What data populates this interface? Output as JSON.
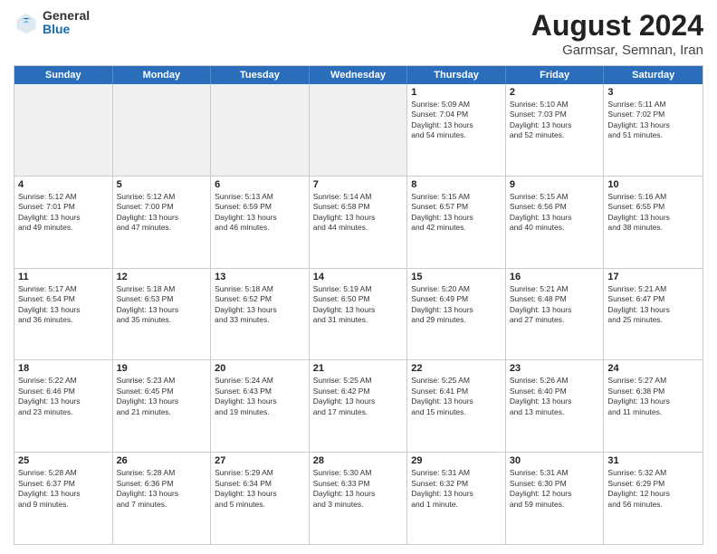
{
  "logo": {
    "general": "General",
    "blue": "Blue"
  },
  "title": {
    "month": "August 2024",
    "location": "Garmsar, Semnan, Iran"
  },
  "header_days": [
    "Sunday",
    "Monday",
    "Tuesday",
    "Wednesday",
    "Thursday",
    "Friday",
    "Saturday"
  ],
  "weeks": [
    [
      {
        "day": "",
        "info": ""
      },
      {
        "day": "",
        "info": ""
      },
      {
        "day": "",
        "info": ""
      },
      {
        "day": "",
        "info": ""
      },
      {
        "day": "1",
        "info": "Sunrise: 5:09 AM\nSunset: 7:04 PM\nDaylight: 13 hours\nand 54 minutes."
      },
      {
        "day": "2",
        "info": "Sunrise: 5:10 AM\nSunset: 7:03 PM\nDaylight: 13 hours\nand 52 minutes."
      },
      {
        "day": "3",
        "info": "Sunrise: 5:11 AM\nSunset: 7:02 PM\nDaylight: 13 hours\nand 51 minutes."
      }
    ],
    [
      {
        "day": "4",
        "info": "Sunrise: 5:12 AM\nSunset: 7:01 PM\nDaylight: 13 hours\nand 49 minutes."
      },
      {
        "day": "5",
        "info": "Sunrise: 5:12 AM\nSunset: 7:00 PM\nDaylight: 13 hours\nand 47 minutes."
      },
      {
        "day": "6",
        "info": "Sunrise: 5:13 AM\nSunset: 6:59 PM\nDaylight: 13 hours\nand 46 minutes."
      },
      {
        "day": "7",
        "info": "Sunrise: 5:14 AM\nSunset: 6:58 PM\nDaylight: 13 hours\nand 44 minutes."
      },
      {
        "day": "8",
        "info": "Sunrise: 5:15 AM\nSunset: 6:57 PM\nDaylight: 13 hours\nand 42 minutes."
      },
      {
        "day": "9",
        "info": "Sunrise: 5:15 AM\nSunset: 6:56 PM\nDaylight: 13 hours\nand 40 minutes."
      },
      {
        "day": "10",
        "info": "Sunrise: 5:16 AM\nSunset: 6:55 PM\nDaylight: 13 hours\nand 38 minutes."
      }
    ],
    [
      {
        "day": "11",
        "info": "Sunrise: 5:17 AM\nSunset: 6:54 PM\nDaylight: 13 hours\nand 36 minutes."
      },
      {
        "day": "12",
        "info": "Sunrise: 5:18 AM\nSunset: 6:53 PM\nDaylight: 13 hours\nand 35 minutes."
      },
      {
        "day": "13",
        "info": "Sunrise: 5:18 AM\nSunset: 6:52 PM\nDaylight: 13 hours\nand 33 minutes."
      },
      {
        "day": "14",
        "info": "Sunrise: 5:19 AM\nSunset: 6:50 PM\nDaylight: 13 hours\nand 31 minutes."
      },
      {
        "day": "15",
        "info": "Sunrise: 5:20 AM\nSunset: 6:49 PM\nDaylight: 13 hours\nand 29 minutes."
      },
      {
        "day": "16",
        "info": "Sunrise: 5:21 AM\nSunset: 6:48 PM\nDaylight: 13 hours\nand 27 minutes."
      },
      {
        "day": "17",
        "info": "Sunrise: 5:21 AM\nSunset: 6:47 PM\nDaylight: 13 hours\nand 25 minutes."
      }
    ],
    [
      {
        "day": "18",
        "info": "Sunrise: 5:22 AM\nSunset: 6:46 PM\nDaylight: 13 hours\nand 23 minutes."
      },
      {
        "day": "19",
        "info": "Sunrise: 5:23 AM\nSunset: 6:45 PM\nDaylight: 13 hours\nand 21 minutes."
      },
      {
        "day": "20",
        "info": "Sunrise: 5:24 AM\nSunset: 6:43 PM\nDaylight: 13 hours\nand 19 minutes."
      },
      {
        "day": "21",
        "info": "Sunrise: 5:25 AM\nSunset: 6:42 PM\nDaylight: 13 hours\nand 17 minutes."
      },
      {
        "day": "22",
        "info": "Sunrise: 5:25 AM\nSunset: 6:41 PM\nDaylight: 13 hours\nand 15 minutes."
      },
      {
        "day": "23",
        "info": "Sunrise: 5:26 AM\nSunset: 6:40 PM\nDaylight: 13 hours\nand 13 minutes."
      },
      {
        "day": "24",
        "info": "Sunrise: 5:27 AM\nSunset: 6:38 PM\nDaylight: 13 hours\nand 11 minutes."
      }
    ],
    [
      {
        "day": "25",
        "info": "Sunrise: 5:28 AM\nSunset: 6:37 PM\nDaylight: 13 hours\nand 9 minutes."
      },
      {
        "day": "26",
        "info": "Sunrise: 5:28 AM\nSunset: 6:36 PM\nDaylight: 13 hours\nand 7 minutes."
      },
      {
        "day": "27",
        "info": "Sunrise: 5:29 AM\nSunset: 6:34 PM\nDaylight: 13 hours\nand 5 minutes."
      },
      {
        "day": "28",
        "info": "Sunrise: 5:30 AM\nSunset: 6:33 PM\nDaylight: 13 hours\nand 3 minutes."
      },
      {
        "day": "29",
        "info": "Sunrise: 5:31 AM\nSunset: 6:32 PM\nDaylight: 13 hours\nand 1 minute."
      },
      {
        "day": "30",
        "info": "Sunrise: 5:31 AM\nSunset: 6:30 PM\nDaylight: 12 hours\nand 59 minutes."
      },
      {
        "day": "31",
        "info": "Sunrise: 5:32 AM\nSunset: 6:29 PM\nDaylight: 12 hours\nand 56 minutes."
      }
    ]
  ]
}
